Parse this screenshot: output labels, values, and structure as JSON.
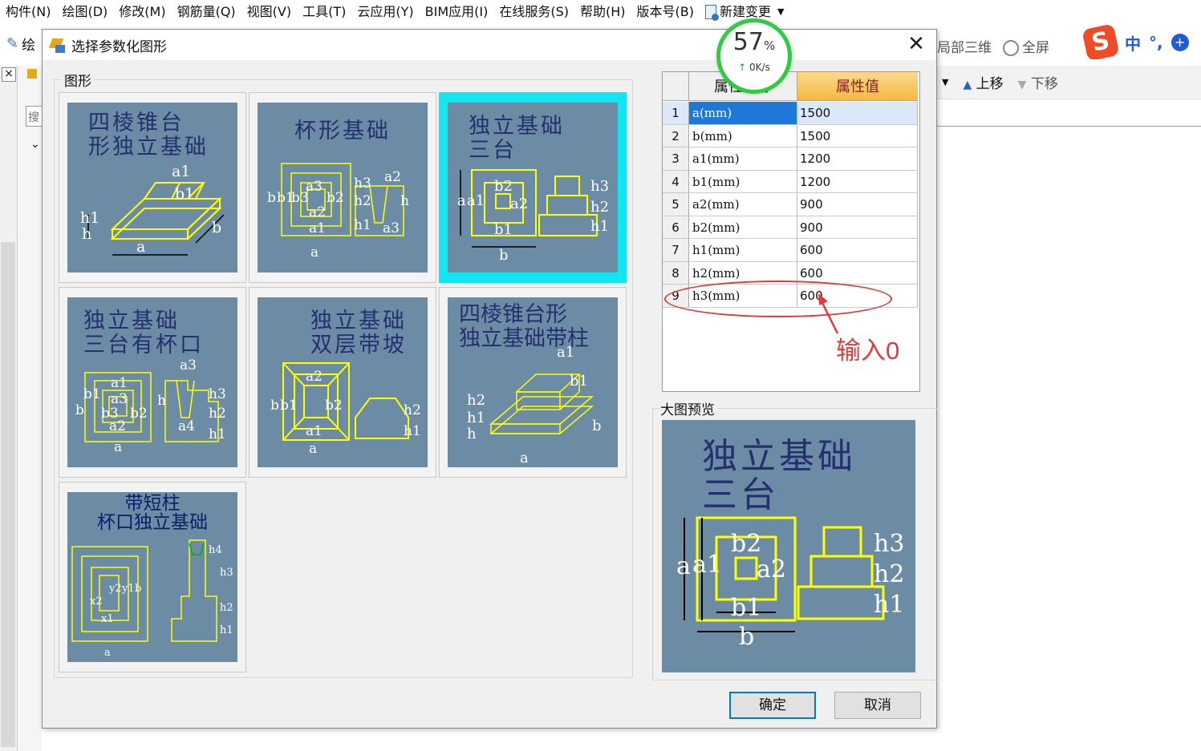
{
  "menubar": {
    "items": [
      "构件(N)",
      "绘图(D)",
      "修改(M)",
      "钢筋量(Q)",
      "视图(V)",
      "工具(T)",
      "云应用(Y)",
      "BIM应用(I)",
      "在线服务(S)",
      "帮助(H)",
      "版本号(B)"
    ],
    "new_change_label": "新建变更"
  },
  "background": {
    "toolbar_partial": "绘",
    "partial_3d_label": "局部三维",
    "fullscreen_label": "全屏",
    "move_up_label": "上移",
    "move_down_label": "下移",
    "search_placeholder": "搜",
    "ime": {
      "lang": "中",
      "punct": "°,"
    }
  },
  "dialog": {
    "title": "选择参数化图形",
    "shape_group_label": "图形",
    "preview_label": "大图预览",
    "ok_label": "确定",
    "cancel_label": "取消"
  },
  "shapes": [
    {
      "title_lines": [
        "四棱锥台",
        "形独立基础"
      ],
      "labels": [
        "a1",
        "b1",
        "h1",
        "h",
        "a",
        "b"
      ],
      "selected": false
    },
    {
      "title_lines": [
        "杯形基础"
      ],
      "labels": [
        "a2",
        "a3",
        "b",
        "b1",
        "b3",
        "b2",
        "a2",
        "a1",
        "h3",
        "h2",
        "h1",
        "h",
        "a3",
        "a"
      ],
      "selected": false
    },
    {
      "title_lines": [
        "独立基础",
        "三台"
      ],
      "labels": [
        "b2",
        "a",
        "a1",
        "a2",
        "b1",
        "b",
        "h3",
        "h2",
        "h1"
      ],
      "selected": true
    },
    {
      "title_lines": [
        "独立基础",
        "三台有杯口"
      ],
      "labels": [
        "a3",
        "a1",
        "b1",
        "a3",
        "b",
        "b3",
        "b2",
        "a2",
        "a",
        "h",
        "a4",
        "h3",
        "h2",
        "h1"
      ],
      "selected": false
    },
    {
      "title_lines": [
        "独立基础",
        "双层带坡"
      ],
      "labels": [
        "a2",
        "b",
        "b1",
        "b2",
        "a1",
        "a",
        "h2",
        "h1"
      ],
      "selected": false
    },
    {
      "title_lines": [
        "四棱锥台形",
        "独立基础带柱"
      ],
      "labels": [
        "a1",
        "b1",
        "h2",
        "h1",
        "h",
        "b",
        "a"
      ],
      "selected": false
    },
    {
      "title_lines": [
        "带短柱",
        "杯口独立基础"
      ],
      "labels": [
        "x2",
        "y2",
        "y1",
        "b",
        "x1",
        "a",
        "h4",
        "h3",
        "h2",
        "h1"
      ],
      "selected": false
    }
  ],
  "property_grid": {
    "headers": {
      "name": "属性名称",
      "value": "属性值"
    },
    "rows": [
      {
        "idx": "1",
        "name": "a(mm)",
        "value": "1500",
        "selected": true
      },
      {
        "idx": "2",
        "name": "b(mm)",
        "value": "1500"
      },
      {
        "idx": "3",
        "name": "a1(mm)",
        "value": "1200"
      },
      {
        "idx": "4",
        "name": "b1(mm)",
        "value": "1200"
      },
      {
        "idx": "5",
        "name": "a2(mm)",
        "value": "900"
      },
      {
        "idx": "6",
        "name": "b2(mm)",
        "value": "900"
      },
      {
        "idx": "7",
        "name": "h1(mm)",
        "value": "600"
      },
      {
        "idx": "8",
        "name": "h2(mm)",
        "value": "600"
      },
      {
        "idx": "9",
        "name": "h3(mm)",
        "value": "600"
      }
    ]
  },
  "preview": {
    "title_lines": [
      "独立基础",
      "三台"
    ],
    "labels": [
      "b2",
      "a",
      "a1",
      "a2",
      "b1",
      "b",
      "h3",
      "h2",
      "h1"
    ]
  },
  "speed_widget": {
    "percent": "57",
    "percent_sign": "%",
    "rate": "0K/s"
  },
  "annotation": {
    "text": "输入0",
    "color": "#e23a3a"
  },
  "colors": {
    "thumb_bg": "#6b8ca4",
    "drawing_line": "#ffff00",
    "selected_cell": "#12e6f2",
    "row_selected": "#1f77d8",
    "header_value_bg": "#f4b844"
  }
}
